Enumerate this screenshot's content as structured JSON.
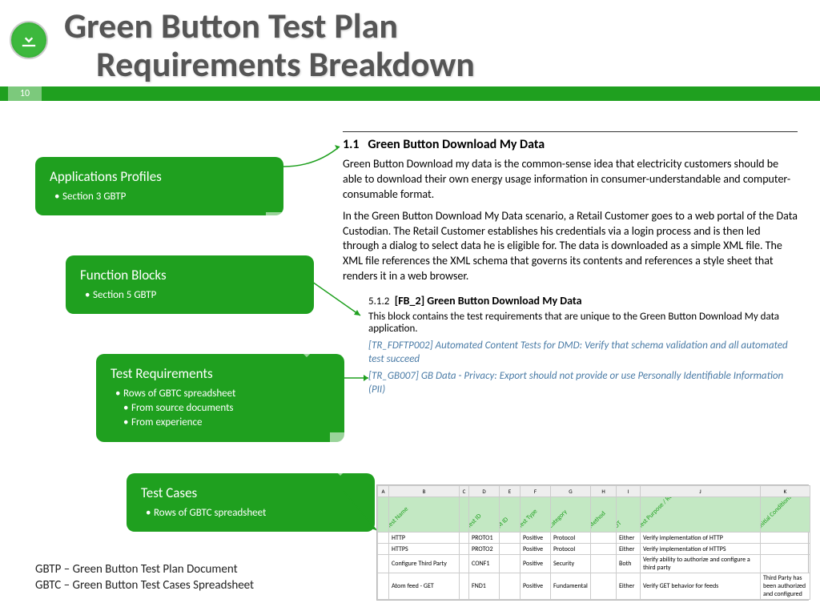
{
  "pageNum": "10",
  "title": {
    "l1": "Green Button Test Plan",
    "l2": "Requirements Breakdown"
  },
  "steps": {
    "s1": {
      "h": "Applications Profiles",
      "b1": "Section 3 GBTP"
    },
    "s2": {
      "h": "Function Blocks",
      "b1": "Section 5 GBTP"
    },
    "s3": {
      "h": "Test Requirements",
      "b1": "Rows of GBTC spreadsheet",
      "b2": "From source documents",
      "b3": "From experience"
    },
    "s4": {
      "h": "Test Cases",
      "b1": "Rows of GBTC spreadsheet"
    }
  },
  "abbr": {
    "l1": "GBTP – Green Button Test Plan Document",
    "l2": "GBTC – Green Button Test Cases Spreadsheet"
  },
  "sec11": {
    "num": "1.1",
    "title": "Green Button Download My Data",
    "p1": "Green Button Download my data is the common-sense idea that electricity customers should be able to download their own energy usage information in consumer-understandable and computer-consumable format.",
    "p2": "In the Green Button Download My Data scenario, a Retail Customer goes to a web portal of the Data Custodian. The Retail Customer establishes his credentials via a login process and is then led through a dialog to select data he is eligible for. The data is downloaded as a simple XML file. The XML file references the XML schema that governs its contents and references a style sheet that renders it in a web browser."
  },
  "sec512": {
    "num": "5.1.2",
    "title": "[FB_2] Green Button Download My Data",
    "p1": "This block contains the test requirements that are unique to the Green Button Download My data application.",
    "tr1": "[TR_FDFTP002] Automated Content Tests for DMD: Verify that schema validation and all automated test succeed",
    "tr2": "[TR_GB007] GB Data - Privacy: Export should not provide or use Personally Identifiable Information (PII)"
  },
  "sheet": {
    "cols": [
      "A",
      "B",
      "C",
      "D",
      "E",
      "F",
      "G",
      "H",
      "I",
      "J",
      "K"
    ],
    "hdrs": [
      "",
      "Test Name",
      "",
      "Test ID",
      "M ID",
      "Test Type",
      "Category",
      "Method",
      "UT",
      "Test Purpose / Requirement",
      "Initial Conditions"
    ],
    "r1": [
      "",
      "HTTP",
      "",
      "PROTO1",
      "",
      "Positive",
      "Protocol",
      "",
      "Either",
      "Verify implementation of HTTP",
      ""
    ],
    "r2": [
      "",
      "HTTPS",
      "",
      "PROTO2",
      "",
      "Positive",
      "Protocol",
      "",
      "Either",
      "Verify implementation of HTTPS",
      ""
    ],
    "r3": [
      "",
      "Configure Third Party",
      "",
      "CONF1",
      "",
      "Positive",
      "Security",
      "",
      "Both",
      "Verify ability to authorize and configure a third party",
      ""
    ],
    "r4": [
      "",
      "Atom feed - GET",
      "",
      "FND1",
      "",
      "Positive",
      "Fundamental",
      "",
      "Either",
      "Verify GET behavior for feeds",
      "Third Party has been authorized and configured"
    ]
  }
}
